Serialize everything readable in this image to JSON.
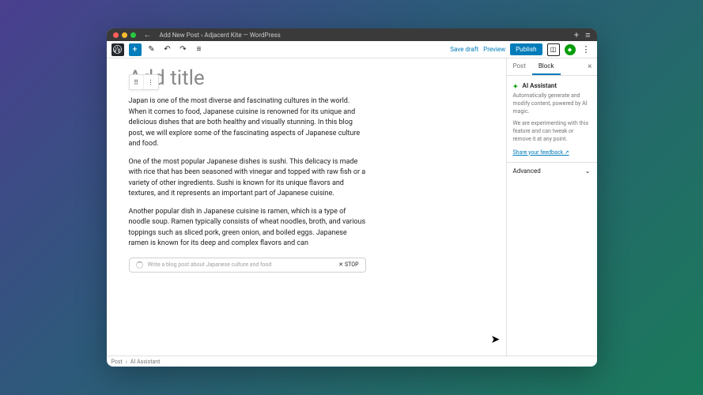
{
  "titlebar": {
    "title": "Add New Post ‹ Adjacent Kite — WordPress"
  },
  "toolbar": {
    "save_draft": "Save draft",
    "preview": "Preview",
    "publish": "Publish"
  },
  "editor": {
    "title_placeholder": "Add title",
    "paragraphs": [
      "Japan is one of the most diverse and fascinating cultures in the world. When it comes to food, Japanese cuisine is renowned for its unique and delicious dishes that are both healthy and visually stunning. In this blog post, we will explore some of the fascinating aspects of Japanese culture and food.",
      "One of the most popular Japanese dishes is sushi. This delicacy is made with rice that has been seasoned with vinegar and topped with raw fish or a variety of other ingredients. Sushi is known for its unique flavors and textures, and it represents an important part of Japanese cuisine.",
      "Another popular dish in Japanese cuisine is ramen, which is a type of noodle soup. Ramen typically consists of wheat noodles, broth, and various toppings such as sliced pork, green onion, and boiled eggs. Japanese ramen is known for its deep and complex flavors and can"
    ],
    "ai_input_placeholder": "Write a blog post about Japanese culture and food",
    "stop_label": "STOP"
  },
  "sidebar": {
    "tabs": {
      "post": "Post",
      "block": "Block"
    },
    "panel": {
      "title": "AI Assistant",
      "desc": "Automatically generate and modify content, powered by AI magic.",
      "note": "We are experimenting with this feature and can tweak or remove it at any point.",
      "feedback": "Share your feedback ↗",
      "advanced": "Advanced"
    }
  },
  "footer": {
    "crumb1": "Post",
    "crumb2": "AI Assistant"
  }
}
